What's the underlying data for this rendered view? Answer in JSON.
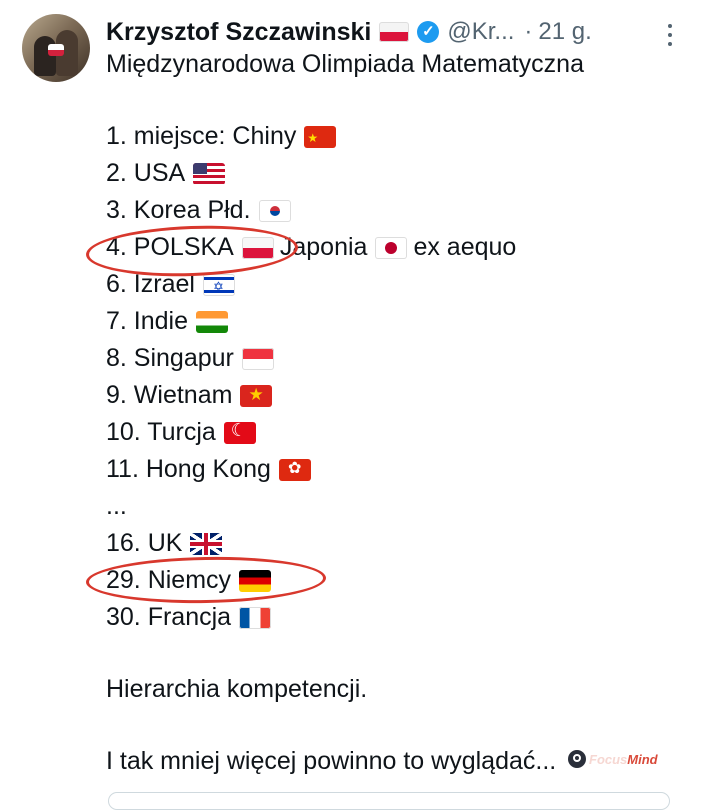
{
  "tweet": {
    "author_name": "Krzysztof Szczawinski",
    "author_flag_icon": "flag-poland-icon",
    "verified_icon": "verified-badge-icon",
    "handle": "@Kr...",
    "separator": "·",
    "time": "21 g.",
    "more_icon": "more-vertical-icon",
    "title": "Międzynarodowa Olimpiada Matematyczna",
    "ranking": [
      {
        "text": "1. miejsce: Chiny",
        "flag_icon": "flag-china-icon"
      },
      {
        "text": "2. USA",
        "flag_icon": "flag-usa-icon"
      },
      {
        "text": "3. Korea Płd.",
        "flag_icon": "flag-south-korea-icon"
      },
      {
        "text": "4. POLSKA",
        "flag_icon": "flag-poland-icon",
        "extra_text": "Japonia",
        "extra_flag_icon": "flag-japan-icon",
        "suffix": "ex aequo",
        "highlighted": true
      },
      {
        "text": "6. Izrael",
        "flag_icon": "flag-israel-icon"
      },
      {
        "text": "7. Indie",
        "flag_icon": "flag-india-icon"
      },
      {
        "text": "8. Singapur",
        "flag_icon": "flag-singapore-icon"
      },
      {
        "text": "9. Wietnam",
        "flag_icon": "flag-vietnam-icon"
      },
      {
        "text": "10. Turcja",
        "flag_icon": "flag-turkey-icon"
      },
      {
        "text": "11. Hong Kong",
        "flag_icon": "flag-hong-kong-icon"
      },
      {
        "text": "...",
        "flag_icon": ""
      },
      {
        "text": "16. UK",
        "flag_icon": "flag-uk-icon"
      },
      {
        "text": "29. Niemcy",
        "flag_icon": "flag-germany-icon",
        "highlighted": true
      },
      {
        "text": "30. Francja",
        "flag_icon": "flag-france-icon"
      }
    ],
    "paragraph_1": "Hierarchia kompetencji.",
    "paragraph_2": "I tak mniej więcej powinno to wyglądać..."
  },
  "watermark": {
    "text_a": "Focus",
    "text_b": "Mind",
    "icon": "focusmind-logo-icon"
  },
  "colors": {
    "text": "#0f1419",
    "muted": "#536471",
    "verified": "#1d9bf0",
    "highlight_oval": "#d8382d"
  }
}
